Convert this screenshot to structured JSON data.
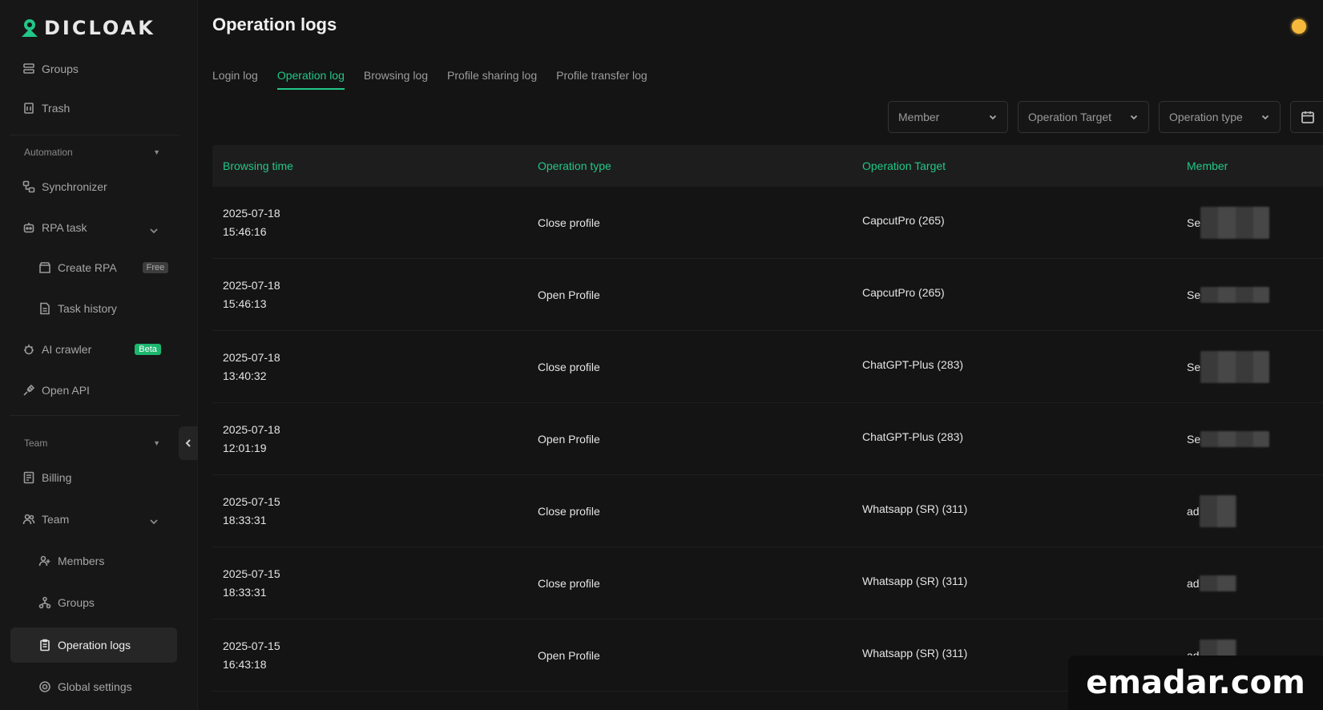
{
  "brand": {
    "name": "DICLOAK"
  },
  "sidebar": {
    "top_items": [
      {
        "label": "Groups",
        "icon": "groups-icon"
      },
      {
        "label": "Trash",
        "icon": "trash-icon"
      }
    ],
    "automation": {
      "label": "Automation",
      "items": [
        {
          "label": "Synchronizer"
        },
        {
          "label": "RPA task"
        },
        {
          "label": "Create RPA",
          "badge": "Free"
        },
        {
          "label": "Task history"
        },
        {
          "label": "AI crawler",
          "badge": "Beta"
        },
        {
          "label": "Open API"
        }
      ]
    },
    "team": {
      "label": "Team",
      "items": [
        {
          "label": "Billing"
        },
        {
          "label": "Team"
        },
        {
          "label": "Members"
        },
        {
          "label": "Groups"
        },
        {
          "label": "Operation logs"
        },
        {
          "label": "Global settings"
        }
      ]
    }
  },
  "header": {
    "title": "Operation logs"
  },
  "tabs": [
    {
      "label": "Login log"
    },
    {
      "label": "Operation log",
      "active": true
    },
    {
      "label": "Browsing log"
    },
    {
      "label": "Profile sharing log"
    },
    {
      "label": "Profile transfer log"
    }
  ],
  "filters": {
    "member": "Member",
    "target": "Operation Target",
    "optype": "Operation type"
  },
  "table": {
    "columns": [
      "Browsing time",
      "Operation type",
      "Operation Target",
      "Member"
    ],
    "rows": [
      {
        "date": "2025-07-18",
        "time": "15:46:16",
        "type": "Close profile",
        "target": "CapcutPro (265)",
        "member": "Se"
      },
      {
        "date": "2025-07-18",
        "time": "15:46:13",
        "type": "Open Profile",
        "target": "CapcutPro (265)",
        "member": "Se"
      },
      {
        "date": "2025-07-18",
        "time": "13:40:32",
        "type": "Close profile",
        "target": "ChatGPT-Plus (283)",
        "member": "Se"
      },
      {
        "date": "2025-07-18",
        "time": "12:01:19",
        "type": "Open Profile",
        "target": "ChatGPT-Plus (283)",
        "member": "Se"
      },
      {
        "date": "2025-07-15",
        "time": "18:33:31",
        "type": "Close profile",
        "target": "Whatsapp (SR) (311)",
        "member": "ad"
      },
      {
        "date": "2025-07-15",
        "time": "18:33:31",
        "type": "Close profile",
        "target": "Whatsapp (SR) (311)",
        "member": "ad"
      },
      {
        "date": "2025-07-15",
        "time": "16:43:18",
        "type": "Open Profile",
        "target": "Whatsapp (SR) (311)",
        "member": "ad"
      }
    ]
  },
  "watermark": {
    "text": "emadar.com"
  },
  "colors": {
    "accent": "#22c788",
    "background": "#141414",
    "sidebar": "#171717",
    "theme_dot": "#f6b93b"
  }
}
